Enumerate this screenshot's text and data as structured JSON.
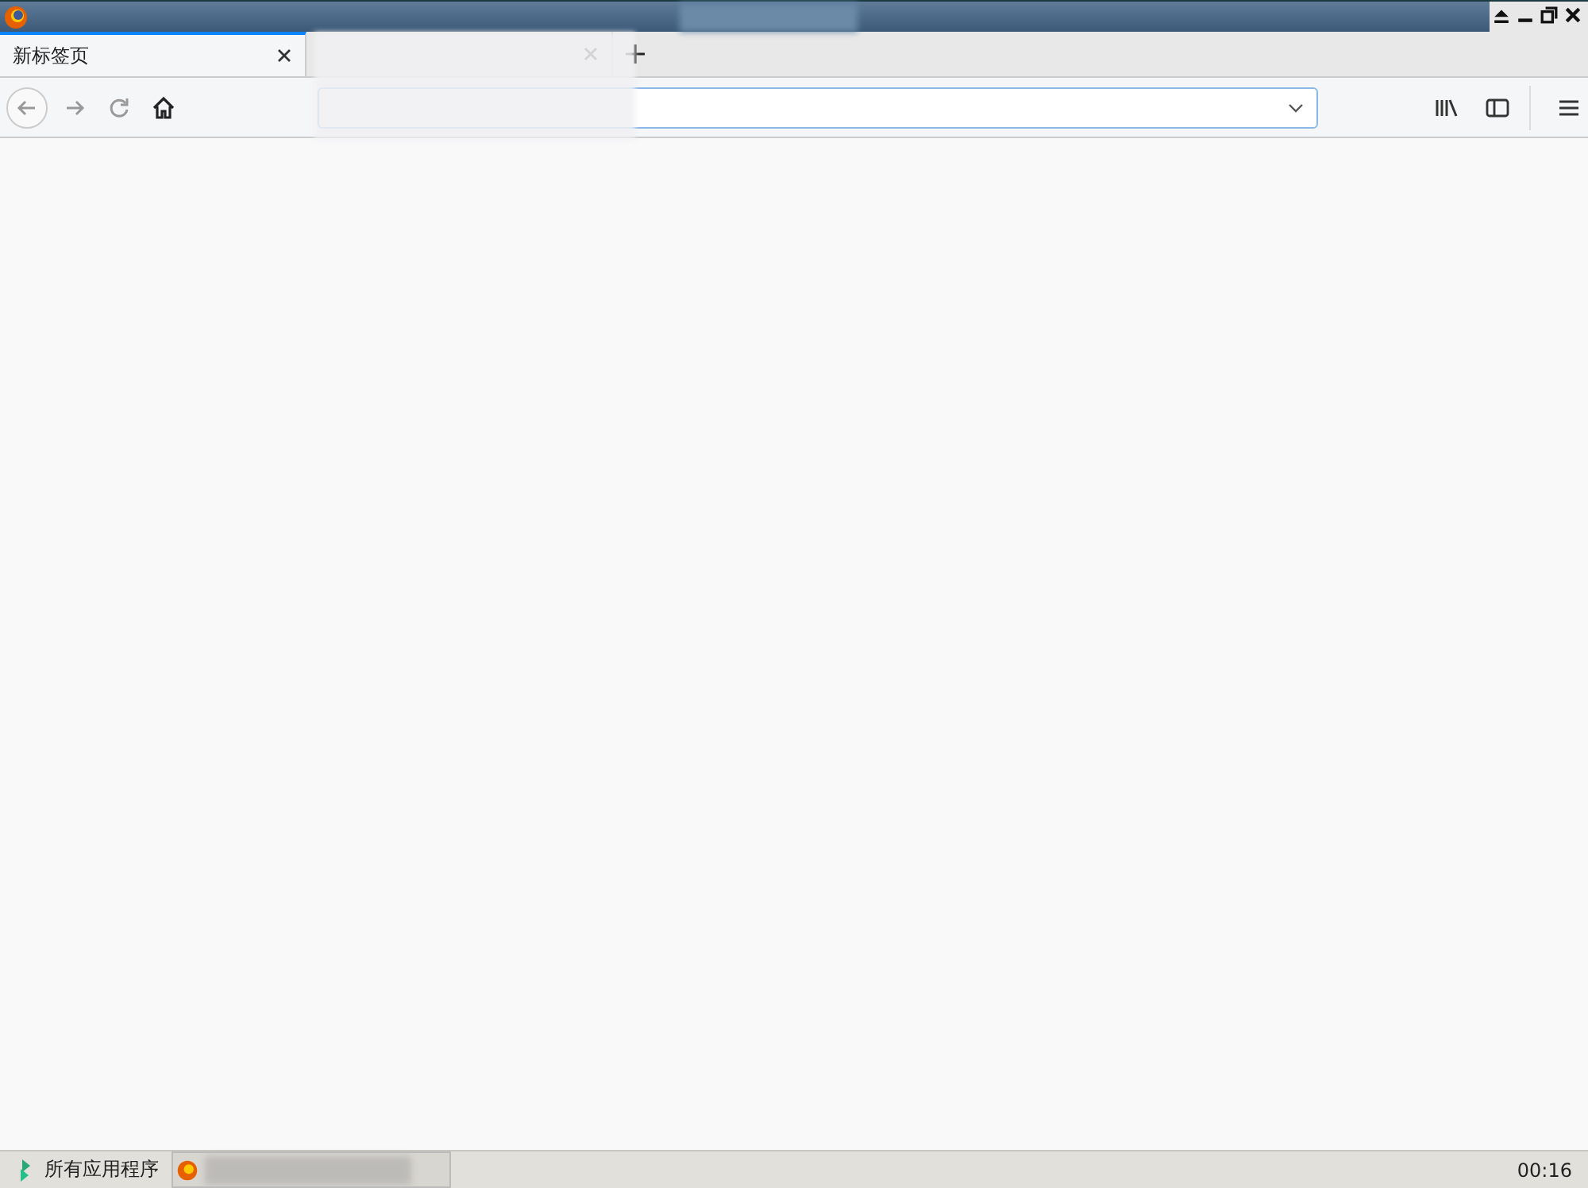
{
  "tabs": [
    {
      "label": "新标签页",
      "selected": true
    },
    {
      "selected": false
    }
  ],
  "taskbar": {
    "start_label": "所有应用程序",
    "clock": "00:16"
  }
}
